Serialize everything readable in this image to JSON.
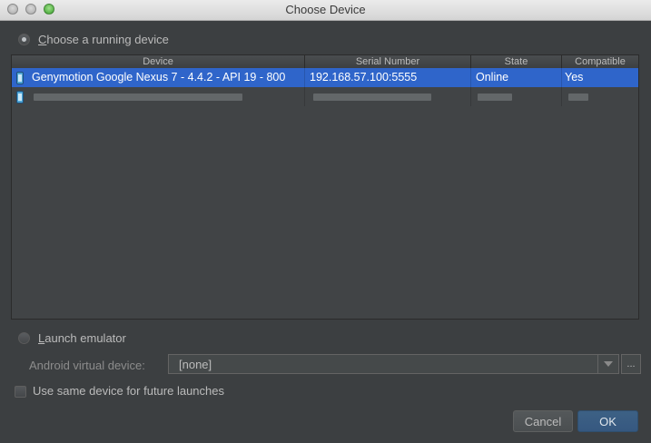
{
  "window": {
    "title": "Choose Device"
  },
  "choose_running": {
    "label_u": "C",
    "label_rest": "hoose a running device",
    "selected": true
  },
  "table": {
    "headers": [
      "Device",
      "Serial Number",
      "State",
      "Compatible"
    ],
    "rows": [
      {
        "device": "Genymotion Google Nexus 7 - 4.4.2 - API 19 - 800",
        "serial": "192.168.57.100:5555",
        "state": "Online",
        "compatible": "Yes",
        "selected": true,
        "icon": "phone-icon"
      },
      {
        "device": "",
        "serial": "",
        "state": "",
        "compatible": "",
        "selected": false,
        "icon": "phone-icon",
        "redacted": true
      }
    ]
  },
  "launch_emulator": {
    "label_u": "L",
    "label_rest": "aunch emulator",
    "selected": false
  },
  "avd": {
    "label": "Android virtual device:",
    "value": "[none]",
    "more_label": "..."
  },
  "same_device": {
    "label": "Use same device for future launches",
    "checked": false
  },
  "buttons": {
    "cancel": "Cancel",
    "ok": "OK"
  },
  "colors": {
    "background": "#3c3f41",
    "selection": "#2f65ca",
    "ok_button": "#365880"
  }
}
